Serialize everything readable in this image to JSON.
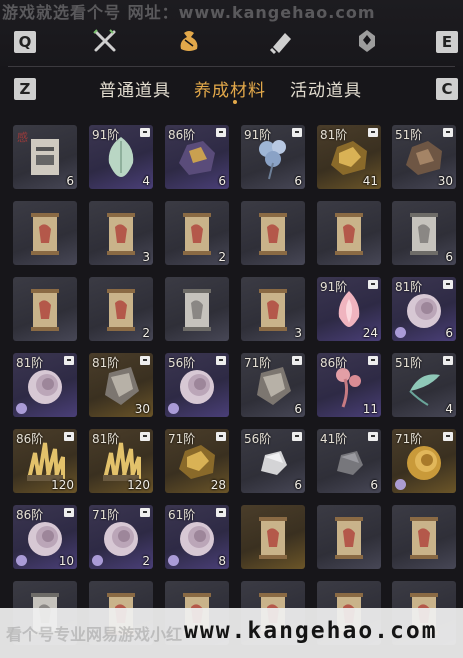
{
  "watermark_top": "游戏就选看个号  网址：www.kangehao.com",
  "keys": {
    "q": "Q",
    "e": "E",
    "z": "Z",
    "c": "C"
  },
  "top_icons": [
    "crossed-swords-icon",
    "money-bag-icon",
    "scroll-icon",
    "map-marker-icon"
  ],
  "tabs": [
    {
      "label": "普通道具",
      "active": false
    },
    {
      "label": "养成材料",
      "active": true
    },
    {
      "label": "活动道具",
      "active": false
    }
  ],
  "items": [
    {
      "tier": "",
      "count": "6",
      "stamp": "感",
      "kind": "paper",
      "bg": "grey"
    },
    {
      "tier": "91阶",
      "count": "4",
      "kind": "jade",
      "bg": "purple"
    },
    {
      "tier": "86阶",
      "count": "6",
      "kind": "ore-purple",
      "bg": "purple"
    },
    {
      "tier": "91阶",
      "count": "6",
      "kind": "flower-blue",
      "bg": "grey"
    },
    {
      "tier": "81阶",
      "count": "41",
      "kind": "ore-gold",
      "bg": "gold"
    },
    {
      "tier": "51阶",
      "count": "30",
      "kind": "ore-brown",
      "bg": "grey"
    },
    {
      "tier": "",
      "count": "",
      "kind": "scroll",
      "bg": "grey"
    },
    {
      "tier": "",
      "count": "3",
      "kind": "scroll",
      "bg": "grey"
    },
    {
      "tier": "",
      "count": "2",
      "kind": "scroll",
      "bg": "grey"
    },
    {
      "tier": "",
      "count": "",
      "kind": "scroll",
      "bg": "grey"
    },
    {
      "tier": "",
      "count": "",
      "kind": "scroll",
      "bg": "grey"
    },
    {
      "tier": "",
      "count": "6",
      "kind": "scroll-grey",
      "bg": "grey"
    },
    {
      "tier": "",
      "count": "",
      "kind": "scroll",
      "bg": "grey"
    },
    {
      "tier": "",
      "count": "2",
      "kind": "scroll",
      "bg": "grey"
    },
    {
      "tier": "",
      "count": "",
      "kind": "scroll-grey",
      "bg": "grey"
    },
    {
      "tier": "",
      "count": "3",
      "kind": "scroll",
      "bg": "grey"
    },
    {
      "tier": "91阶",
      "count": "24",
      "kind": "lotus",
      "bg": "purple"
    },
    {
      "tier": "81阶",
      "count": "6",
      "kind": "shell",
      "bg": "purple",
      "badge": true
    },
    {
      "tier": "81阶",
      "count": "",
      "kind": "shell",
      "bg": "purple",
      "badge": true
    },
    {
      "tier": "81阶",
      "count": "30",
      "kind": "ore-paper",
      "bg": "gold"
    },
    {
      "tier": "56阶",
      "count": "",
      "kind": "shell",
      "bg": "purple",
      "badge": true
    },
    {
      "tier": "71阶",
      "count": "6",
      "kind": "ore-paper",
      "bg": "grey"
    },
    {
      "tier": "86阶",
      "count": "11",
      "kind": "flower-pink",
      "bg": "purple"
    },
    {
      "tier": "51阶",
      "count": "4",
      "kind": "flower-teal",
      "bg": "grey"
    },
    {
      "tier": "86阶",
      "count": "120",
      "kind": "crystal-gold",
      "bg": "gold"
    },
    {
      "tier": "81阶",
      "count": "120",
      "kind": "crystal-gold",
      "bg": "gold"
    },
    {
      "tier": "71阶",
      "count": "28",
      "kind": "ore-gold",
      "bg": "gold"
    },
    {
      "tier": "56阶",
      "count": "6",
      "kind": "stone-grey",
      "bg": "grey"
    },
    {
      "tier": "41阶",
      "count": "6",
      "kind": "stone-dark",
      "bg": "grey"
    },
    {
      "tier": "71阶",
      "count": "",
      "kind": "shell-gold",
      "bg": "gold",
      "badge": true
    },
    {
      "tier": "86阶",
      "count": "10",
      "kind": "shell",
      "bg": "purple",
      "badge": true
    },
    {
      "tier": "71阶",
      "count": "2",
      "kind": "shell",
      "bg": "purple",
      "badge": true
    },
    {
      "tier": "61阶",
      "count": "8",
      "kind": "shell",
      "bg": "purple",
      "badge": true
    },
    {
      "tier": "",
      "count": "",
      "kind": "scroll",
      "bg": "gold"
    },
    {
      "tier": "",
      "count": "",
      "kind": "scroll",
      "bg": "grey"
    },
    {
      "tier": "",
      "count": "",
      "kind": "scroll",
      "bg": "grey"
    },
    {
      "tier": "",
      "count": "",
      "kind": "scroll-grey",
      "bg": "grey"
    },
    {
      "tier": "",
      "count": "",
      "kind": "scroll",
      "bg": "grey"
    },
    {
      "tier": "",
      "count": "",
      "kind": "scroll",
      "bg": "grey"
    },
    {
      "tier": "",
      "count": "",
      "kind": "scroll",
      "bg": "grey"
    },
    {
      "tier": "",
      "count": "",
      "kind": "scroll",
      "bg": "grey"
    },
    {
      "tier": "",
      "count": "",
      "kind": "scroll",
      "bg": "grey"
    }
  ],
  "watermark_bottom": {
    "left": "看个号专业网易游戏小红",
    "url": "www.kangehao.com"
  },
  "colors": {
    "accent": "#e2a84a",
    "background": "#17161a"
  }
}
